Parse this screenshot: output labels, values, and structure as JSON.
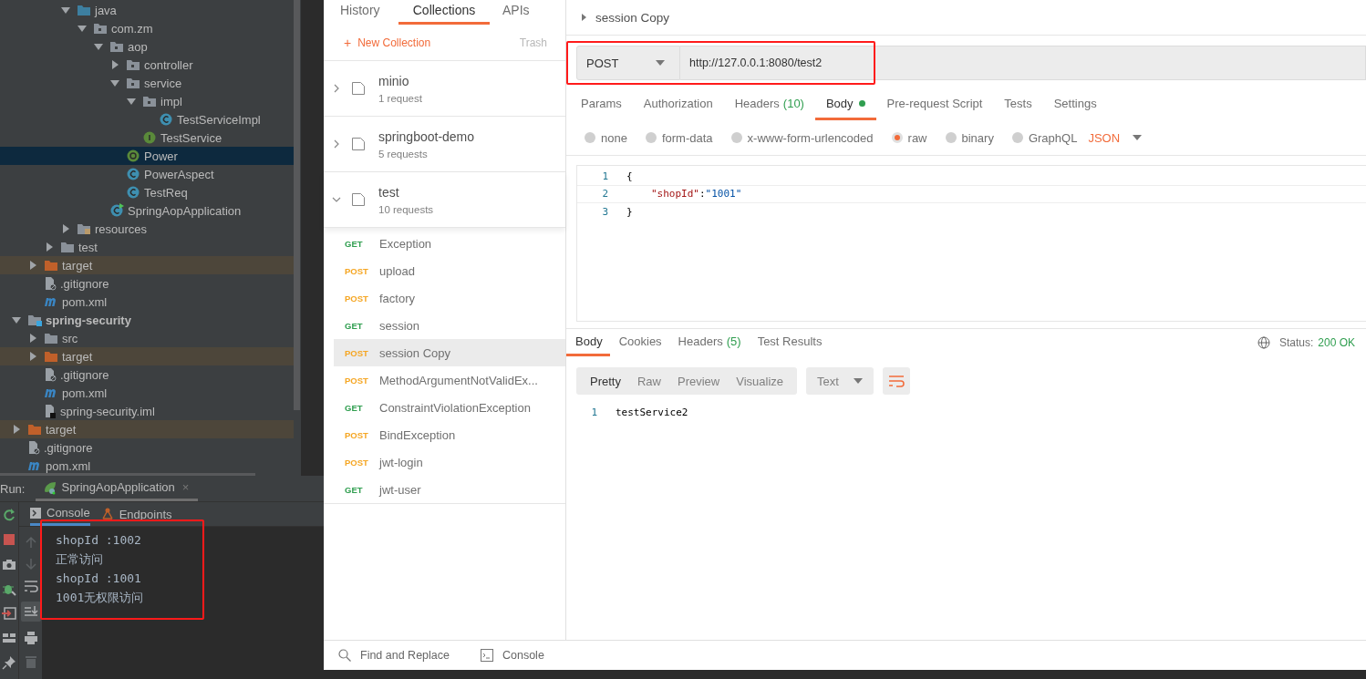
{
  "ide": {
    "project_tree": [
      {
        "children": [
          {
            "children": [
              {
                "children": [
                  {
                    "name": "java",
                    "kind": "source-folder",
                    "expanded": true,
                    "children": [
                      {
                        "name": "com.zm",
                        "kind": "package",
                        "expanded": true,
                        "children": [
                          {
                            "name": "aop",
                            "kind": "package",
                            "expanded": true,
                            "children": [
                              {
                                "name": "controller",
                                "kind": "package",
                                "expanded": false
                              },
                              {
                                "name": "service",
                                "kind": "package",
                                "expanded": true,
                                "children": [
                                  {
                                    "name": "impl",
                                    "kind": "package",
                                    "expanded": true,
                                    "children": [
                                      {
                                        "name": "TestServiceImpl",
                                        "kind": "class",
                                        "selected": false
                                      }
                                    ]
                                  },
                                  {
                                    "name": "TestService",
                                    "kind": "interface",
                                    "selected": false
                                  }
                                ]
                              },
                              {
                                "name": "Power",
                                "kind": "annotation",
                                "selected": true
                              },
                              {
                                "name": "PowerAspect",
                                "kind": "class",
                                "selected": false
                              },
                              {
                                "name": "TestReq",
                                "kind": "class",
                                "selected": false
                              }
                            ]
                          },
                          {
                            "name": "SpringAopApplication",
                            "kind": "app",
                            "selected": false
                          }
                        ]
                      }
                    ]
                  },
                  {
                    "name": "resources",
                    "kind": "resources-folder",
                    "expanded": false
                  }
                ]
              },
              {
                "name": "test",
                "kind": "folder",
                "expanded": false
              }
            ]
          },
          {
            "name": "target",
            "kind": "excluded-folder",
            "expanded": false
          },
          {
            "name": ".gitignore",
            "kind": "ignore-file",
            "selected": false
          },
          {
            "name": "pom.xml",
            "kind": "maven-file",
            "selected": false
          }
        ]
      },
      {
        "name": "spring-security",
        "kind": "module",
        "expanded": true,
        "children": [
          {
            "name": "src",
            "kind": "folder",
            "expanded": false
          },
          {
            "name": "target",
            "kind": "excluded-folder",
            "expanded": false
          },
          {
            "name": ".gitignore",
            "kind": "ignore-file",
            "selected": false
          },
          {
            "name": "pom.xml",
            "kind": "maven-file",
            "selected": false
          },
          {
            "name": "spring-security.iml",
            "kind": "iml-file",
            "selected": false
          }
        ]
      },
      {
        "name": "target",
        "kind": "excluded-folder",
        "expanded": false
      },
      {
        "name": ".gitignore",
        "kind": "ignore-file",
        "selected": false
      },
      {
        "name": "pom.xml",
        "kind": "maven-file",
        "selected": false
      }
    ],
    "run_panel": {
      "label": "Run:",
      "tab": "SpringAopApplication",
      "close": "×",
      "subtabs": [
        {
          "label": "Console",
          "selected": true
        },
        {
          "label": "Endpoints",
          "selected": false
        }
      ],
      "highlighted": true,
      "console_lines": [
        "shopId :1002",
        "正常访问",
        "shopId :1001",
        "1001无权限访问"
      ]
    }
  },
  "postman": {
    "sidebar_tabs": [
      {
        "label": "History",
        "selected": false
      },
      {
        "label": "Collections",
        "selected": true
      },
      {
        "label": "APIs",
        "selected": false
      }
    ],
    "new_collection": {
      "icon": "+",
      "label": "New Collection"
    },
    "trash": "Trash",
    "collections": [
      {
        "name": "minio",
        "count": "1 request",
        "expanded": false
      },
      {
        "name": "springboot-demo",
        "count": "5 requests",
        "expanded": false
      },
      {
        "name": "test",
        "count": "10 requests",
        "expanded": true
      }
    ],
    "requests": [
      {
        "method": "GET",
        "color": "#2f9e4f",
        "name": "Exception",
        "selected": false
      },
      {
        "method": "POST",
        "color": "#f5a623",
        "name": "upload",
        "selected": false
      },
      {
        "method": "POST",
        "color": "#f5a623",
        "name": "factory",
        "selected": false
      },
      {
        "method": "GET",
        "color": "#2f9e4f",
        "name": "session",
        "selected": false
      },
      {
        "method": "POST",
        "color": "#f5a623",
        "name": "session Copy",
        "selected": true
      },
      {
        "method": "POST",
        "color": "#f5a623",
        "name": "MethodArgumentNotValidEx...",
        "selected": false
      },
      {
        "method": "GET",
        "color": "#2f9e4f",
        "name": "ConstraintViolationException",
        "selected": false
      },
      {
        "method": "POST",
        "color": "#f5a623",
        "name": "BindException",
        "selected": false
      },
      {
        "method": "POST",
        "color": "#f5a623",
        "name": "jwt-login",
        "selected": false
      },
      {
        "method": "GET",
        "color": "#2f9e4f",
        "name": "jwt-user",
        "selected": false
      }
    ],
    "request": {
      "title": "session Copy",
      "method": "POST",
      "url": "http://127.0.0.1:8080/test2",
      "highlighted": true,
      "tabs": [
        {
          "label": "Params",
          "selected": false
        },
        {
          "label": "Authorization",
          "selected": false
        },
        {
          "label": "Headers",
          "count": "(10)",
          "selected": false
        },
        {
          "label": "Body",
          "modified": true,
          "selected": true
        },
        {
          "label": "Pre-request Script",
          "selected": false
        },
        {
          "label": "Tests",
          "selected": false
        },
        {
          "label": "Settings",
          "selected": false
        }
      ],
      "body_modes": [
        {
          "label": "none",
          "selected": false
        },
        {
          "label": "form-data",
          "selected": false
        },
        {
          "label": "x-www-form-urlencoded",
          "selected": false
        },
        {
          "label": "raw",
          "selected": true
        },
        {
          "label": "binary",
          "selected": false
        },
        {
          "label": "GraphQL",
          "selected": false
        }
      ],
      "format": "JSON",
      "code_lines": [
        {
          "number": "1",
          "tokens": [
            {
              "text": "{",
              "kind": "punct"
            }
          ]
        },
        {
          "number": "2",
          "indented": true,
          "tokens": [
            {
              "text": "\"shopId\"",
              "kind": "key"
            },
            {
              "text": ":",
              "kind": "punct"
            },
            {
              "text": "\"1001\"",
              "kind": "string"
            }
          ]
        },
        {
          "number": "3",
          "tokens": [
            {
              "text": "}",
              "kind": "punct"
            }
          ]
        }
      ]
    },
    "response": {
      "tabs": [
        {
          "label": "Body",
          "selected": true
        },
        {
          "label": "Cookies",
          "selected": false
        },
        {
          "label": "Headers",
          "count": "(5)",
          "selected": false
        },
        {
          "label": "Test Results",
          "selected": false
        }
      ],
      "status_label": "Status:",
      "status": "200 OK",
      "view_modes": [
        {
          "label": "Pretty",
          "selected": true
        },
        {
          "label": "Raw",
          "selected": false
        },
        {
          "label": "Preview",
          "selected": false
        },
        {
          "label": "Visualize",
          "selected": false
        }
      ],
      "format": "Text",
      "lines": [
        {
          "number": "1",
          "text": "testService2"
        }
      ]
    },
    "footer": [
      "Find and Replace",
      "Console"
    ]
  }
}
